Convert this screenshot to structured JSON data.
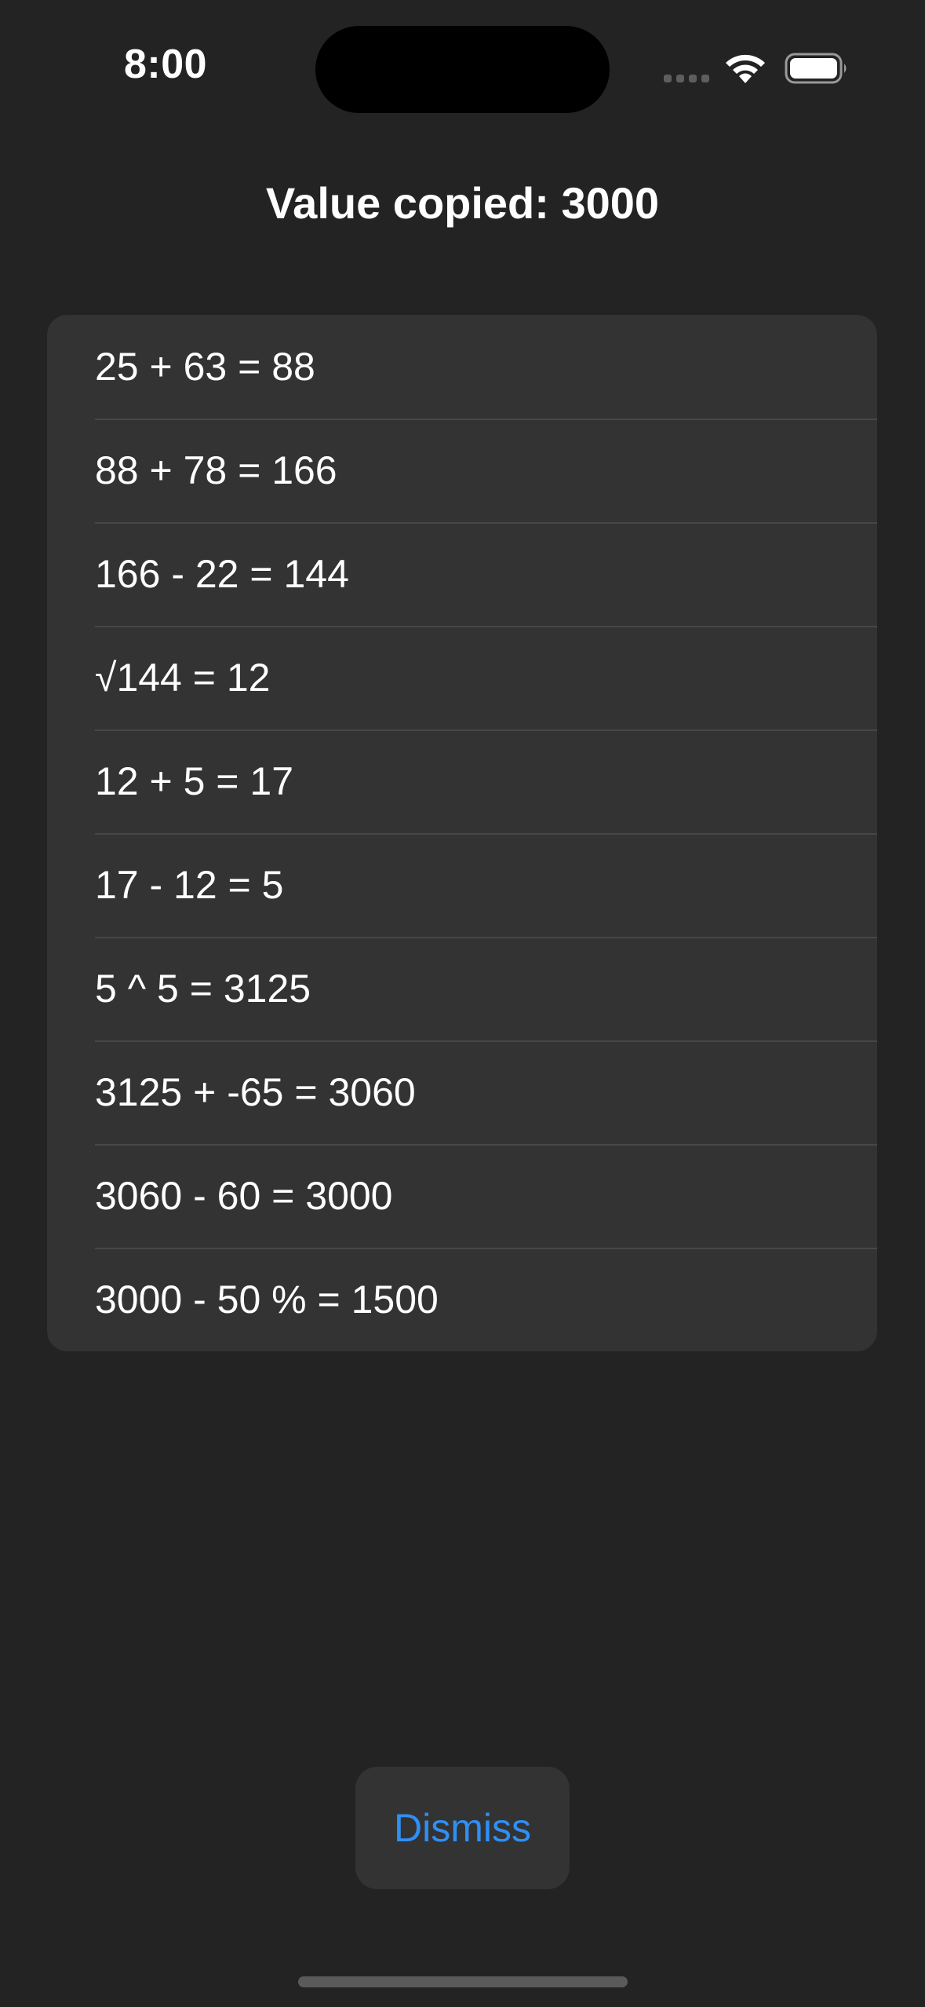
{
  "status_bar": {
    "time": "8:00"
  },
  "header": {
    "title": "Value copied: 3000"
  },
  "history": {
    "rows": [
      "25 + 63 = 88",
      "88 + 78 = 166",
      "166 - 22 = 144",
      "√144 = 12",
      "12 + 5 = 17",
      "17 - 12 = 5",
      "5 ^ 5 = 3125",
      "3125 + -65 = 3060",
      "3060 - 60 = 3000",
      "3000 - 50 % = 1500"
    ]
  },
  "actions": {
    "dismiss_label": "Dismiss"
  },
  "colors": {
    "background": "#232323",
    "card": "#333333",
    "accent": "#2f8ff5"
  }
}
